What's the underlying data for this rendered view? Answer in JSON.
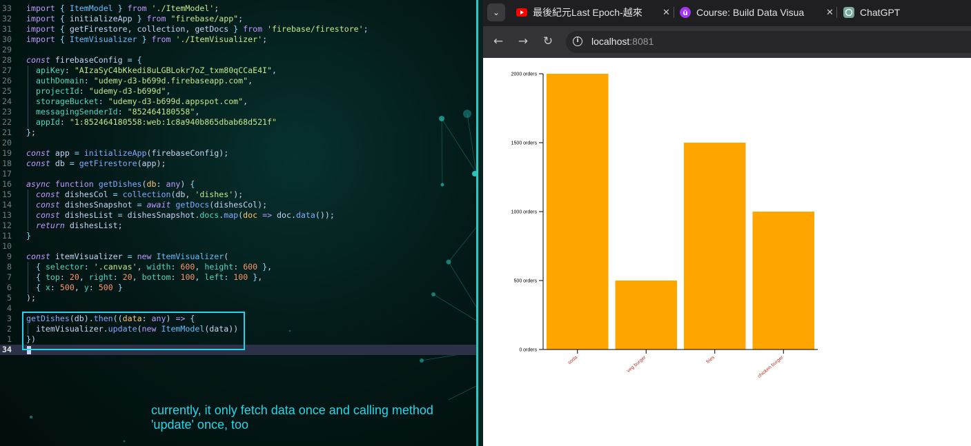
{
  "editor": {
    "lines": [
      {
        "n": "33",
        "html": "<span class='kw2'>import</span> <span class='brk'>{</span> <span class='cls'>ItemModel</span> <span class='brk'>}</span> <span class='kw2'>from</span> <span class='str'>'./ItemModel'</span>;"
      },
      {
        "n": "32",
        "html": "<span class='kw2'>import</span> <span class='brk'>{</span> initializeApp <span class='brk'>}</span> <span class='kw2'>from</span> <span class='str'>\"firebase/app\"</span>;"
      },
      {
        "n": "31",
        "html": "<span class='kw2'>import</span> <span class='brk'>{</span> getFirestore, collection, getDocs <span class='brk'>}</span> <span class='kw2'>from</span> <span class='str'>'firebase/firestore'</span>;"
      },
      {
        "n": "30",
        "html": "<span class='kw2'>import</span> <span class='brk'>{</span> <span class='cls'>ItemVisualizer</span> <span class='brk'>}</span> <span class='kw2'>from</span> <span class='str'>'./ItemVisualizer'</span>;"
      },
      {
        "n": "29",
        "html": ""
      },
      {
        "n": "28",
        "html": "<span class='kw'>const</span> firebaseConfig <span class='op'>=</span> <span class='brk'>{</span>"
      },
      {
        "n": "27",
        "guide": true,
        "html": "  <span class='prop'>apiKey</span>: <span class='str'>\"AIzaSyC4bKkedi8uLGBLokr7oZ_txm80qCCaE4I\"</span>,"
      },
      {
        "n": "26",
        "guide": true,
        "html": "  <span class='prop'>authDomain</span>: <span class='str'>\"udemy-d3-b699d.firebaseapp.com\"</span>,"
      },
      {
        "n": "25",
        "guide": true,
        "html": "  <span class='prop'>projectId</span>: <span class='str'>\"udemy-d3-b699d\"</span>,"
      },
      {
        "n": "24",
        "guide": true,
        "html": "  <span class='prop'>storageBucket</span>: <span class='str'>\"udemy-d3-b699d.appspot.com\"</span>,"
      },
      {
        "n": "23",
        "guide": true,
        "html": "  <span class='prop'>messagingSenderId</span>: <span class='str'>\"852464180558\"</span>,"
      },
      {
        "n": "22",
        "guide": true,
        "html": "  <span class='prop'>appId</span>: <span class='str'>\"1:852464180558:web:1c8a940b865dbab68d521f\"</span>"
      },
      {
        "n": "21",
        "html": "<span class='brk'>}</span>;"
      },
      {
        "n": "20",
        "html": ""
      },
      {
        "n": "19",
        "html": "<span class='kw'>const</span> app <span class='op'>=</span> <span class='fn'>initializeApp</span>(firebaseConfig);"
      },
      {
        "n": "18",
        "html": "<span class='kw'>const</span> db <span class='op'>=</span> <span class='fn'>getFirestore</span>(app);"
      },
      {
        "n": "17",
        "html": ""
      },
      {
        "n": "16",
        "html": "<span class='kw'>async</span> <span class='kw2'>function</span> <span class='fn'>getDishes</span>(<span class='par'>db</span>: <span class='kw2'>any</span>) <span class='brk'>{</span>"
      },
      {
        "n": "15",
        "guide": true,
        "html": "  <span class='kw'>const</span> dishesCol <span class='op'>=</span> <span class='fn'>collection</span>(db, <span class='str'>'dishes'</span>);"
      },
      {
        "n": "14",
        "guide": true,
        "html": "  <span class='kw'>const</span> dishesSnapshot <span class='op'>=</span> <span class='kw'>await</span> <span class='fn'>getDocs</span>(dishesCol);"
      },
      {
        "n": "13",
        "guide": true,
        "html": "  <span class='kw'>const</span> dishesList <span class='op'>=</span> dishesSnapshot.<span class='prop'>docs</span>.<span class='fn'>map</span>(<span class='par'>doc</span> <span class='kw2'>=&gt;</span> doc.<span class='fn'>data</span>());"
      },
      {
        "n": "12",
        "guide": true,
        "html": "  <span class='kw'>return</span> dishesList;"
      },
      {
        "n": "11",
        "html": "<span class='brk'>}</span>"
      },
      {
        "n": "10",
        "html": ""
      },
      {
        "n": "9",
        "html": "<span class='kw'>const</span> itemVisualizer <span class='op'>=</span> <span class='kw2'>new</span> <span class='cls'>ItemVisualizer</span>("
      },
      {
        "n": "8",
        "guide": true,
        "html": "  <span class='brk'>{</span> <span class='prop'>selector</span>: <span class='str'>'.canvas'</span>, <span class='prop'>width</span>: <span class='num'>600</span>, <span class='prop'>height</span>: <span class='num'>600</span> <span class='brk'>}</span>,"
      },
      {
        "n": "7",
        "guide": true,
        "html": "  <span class='brk'>{</span> <span class='prop'>top</span>: <span class='num'>20</span>, <span class='prop'>right</span>: <span class='num'>20</span>, <span class='prop'>bottom</span>: <span class='num'>100</span>, <span class='prop'>left</span>: <span class='num'>100</span> <span class='brk'>}</span>,"
      },
      {
        "n": "6",
        "guide": true,
        "html": "  <span class='brk'>{</span> <span class='prop'>x</span>: <span class='num'>500</span>, <span class='prop'>y</span>: <span class='num'>500</span> <span class='brk'>}</span>"
      },
      {
        "n": "5",
        "html": ");"
      },
      {
        "n": "4",
        "html": ""
      },
      {
        "n": "3",
        "html": "<span class='fn'>getDishes</span>(db).<span class='fn'>then</span>((<span class='par'>data</span>: <span class='kw2'>any</span>) <span class='kw2'>=&gt;</span> <span class='brk'>{</span>"
      },
      {
        "n": "2",
        "guide": true,
        "html": "  itemVisualizer.<span class='fn'>update</span>(<span class='kw2'>new</span> <span class='cls'>ItemModel</span>(data))"
      },
      {
        "n": "1",
        "html": "<span class='brk'>}</span>)"
      },
      {
        "n": "34",
        "current": true,
        "html": ""
      }
    ],
    "annotation": "currently, it only fetch data once and calling method 'update' once, too"
  },
  "browser": {
    "tabs": [
      {
        "title": "最後紀元Last Epoch-越來",
        "icon": "youtube-icon"
      },
      {
        "title": "Course: Build Data Visua",
        "icon": "udemy-icon"
      },
      {
        "title": "ChatGPT",
        "icon": "chatgpt-icon"
      }
    ],
    "url_host": "localhost",
    "url_port": ":8081"
  },
  "chart_data": {
    "type": "bar",
    "categories": [
      "soda",
      "veg burger",
      "fries",
      "chicken burger"
    ],
    "values": [
      2000,
      500,
      1500,
      1000
    ],
    "ylim": [
      0,
      2000
    ],
    "yticks": [
      0,
      500,
      1000,
      1500,
      2000
    ],
    "tick_suffix": " orders",
    "bar_color": "#ffa500",
    "label_color": "#c0392b"
  }
}
